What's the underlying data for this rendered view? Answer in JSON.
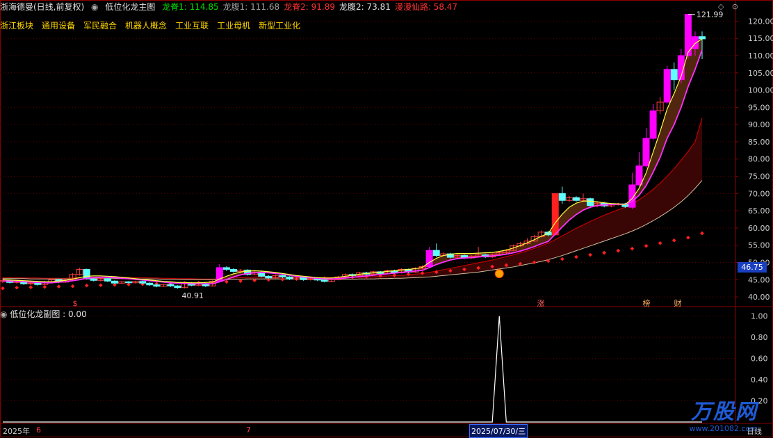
{
  "header": {
    "stock": "浙海德曼(日线,前复权)",
    "indicator": "低位化龙主图",
    "items": [
      {
        "label": "龙脊1: 114.85",
        "color": "#00e000"
      },
      {
        "label": "龙腹1: 111.68",
        "color": "#a0a0a0"
      },
      {
        "label": "龙脊2: 91.89",
        "color": "#ff3030"
      },
      {
        "label": "龙腹2: 73.81",
        "color": "#e0e0e0"
      },
      {
        "label": "漫漫仙路: 58.47",
        "color": "#ff3030"
      }
    ]
  },
  "sectors": [
    "浙江板块",
    "通用设备",
    "军民融合",
    "机器人概念",
    "工业互联",
    "工业母机",
    "新型工业化"
  ],
  "sub_chart": {
    "title": "低位化龙副图 : 0.00"
  },
  "price_label": "46.75",
  "max_label": "121.99",
  "min_label": "40.91",
  "markers": {
    "zhang": "涨",
    "bang": "榜",
    "cai": "财",
    "dollar": "$"
  },
  "dates": {
    "year": "2025年",
    "m6": "6",
    "m7": "7",
    "cursor": "2025/07/30/三"
  },
  "period": "日线",
  "watermark": {
    "brand": "万股网",
    "url": "www.201082.com"
  },
  "chart_data": {
    "type": "candlestick",
    "y_ticks": [
      40.0,
      45.0,
      50.0,
      55.0,
      60.0,
      65.0,
      70.0,
      75.0,
      80.0,
      85.0,
      90.0,
      95.0,
      100.0,
      105.0,
      110.0,
      115.0,
      120.0
    ],
    "ylim": [
      38.0,
      122.5
    ],
    "sub_y_ticks": [
      0.2,
      0.4,
      0.6,
      0.8,
      1.0
    ],
    "sub_ylim": [
      0.0,
      1.05
    ],
    "candles": [
      [
        44.5,
        44.8,
        44.0,
        45.5
      ],
      [
        44.8,
        44.2,
        43.9,
        45.0
      ],
      [
        44.2,
        44.6,
        43.8,
        44.9
      ],
      [
        44.6,
        43.8,
        43.5,
        44.8
      ],
      [
        43.8,
        44.0,
        43.4,
        44.3
      ],
      [
        44.0,
        43.6,
        43.3,
        44.2
      ],
      [
        43.6,
        44.4,
        43.5,
        44.7
      ],
      [
        44.4,
        45.0,
        44.1,
        45.3
      ],
      [
        45.0,
        44.3,
        44.0,
        45.1
      ],
      [
        44.3,
        44.9,
        44.1,
        45.2
      ],
      [
        44.9,
        46.5,
        44.7,
        46.9
      ],
      [
        46.5,
        48.0,
        46.2,
        48.5
      ],
      [
        48.0,
        45.2,
        45.0,
        48.2
      ],
      [
        45.2,
        44.8,
        44.5,
        45.6
      ],
      [
        44.8,
        45.3,
        44.5,
        45.6
      ],
      [
        45.3,
        44.6,
        44.3,
        45.4
      ],
      [
        44.6,
        44.0,
        43.8,
        44.8
      ],
      [
        44.0,
        44.4,
        43.8,
        44.6
      ],
      [
        44.4,
        44.1,
        43.9,
        44.6
      ],
      [
        44.1,
        44.5,
        43.9,
        44.7
      ],
      [
        44.5,
        44.0,
        43.7,
        44.7
      ],
      [
        44.0,
        43.5,
        43.2,
        44.2
      ],
      [
        43.5,
        43.1,
        42.8,
        43.8
      ],
      [
        43.1,
        43.6,
        42.9,
        43.8
      ],
      [
        43.6,
        43.2,
        42.9,
        43.9
      ],
      [
        43.2,
        42.7,
        42.4,
        43.4
      ],
      [
        42.7,
        44.0,
        42.5,
        44.2
      ],
      [
        44.0,
        43.4,
        43.1,
        44.3
      ],
      [
        43.4,
        43.9,
        43.1,
        44.1
      ],
      [
        43.9,
        43.2,
        42.9,
        44.1
      ],
      [
        43.2,
        44.5,
        43.0,
        44.8
      ],
      [
        44.5,
        48.5,
        44.3,
        49.5
      ],
      [
        48.5,
        48.0,
        47.5,
        48.9
      ],
      [
        48.0,
        47.4,
        47.0,
        48.3
      ],
      [
        47.4,
        47.8,
        47.0,
        48.1
      ],
      [
        47.8,
        46.5,
        46.2,
        48.0
      ],
      [
        46.5,
        47.2,
        46.3,
        47.5
      ],
      [
        47.2,
        46.0,
        45.7,
        47.4
      ],
      [
        46.0,
        45.5,
        45.2,
        46.3
      ],
      [
        45.5,
        46.2,
        45.3,
        46.5
      ],
      [
        46.2,
        45.8,
        45.5,
        46.5
      ],
      [
        45.8,
        45.2,
        44.9,
        46.0
      ],
      [
        45.2,
        45.7,
        44.9,
        45.9
      ],
      [
        45.7,
        45.0,
        44.7,
        45.9
      ],
      [
        45.0,
        45.5,
        44.8,
        45.8
      ],
      [
        45.5,
        44.9,
        44.6,
        45.7
      ],
      [
        44.9,
        44.5,
        44.2,
        45.1
      ],
      [
        44.5,
        45.0,
        44.2,
        45.3
      ],
      [
        45.0,
        45.8,
        44.8,
        46.1
      ],
      [
        45.8,
        46.5,
        45.6,
        46.8
      ],
      [
        46.5,
        46.2,
        45.9,
        46.8
      ],
      [
        46.2,
        47.0,
        46.0,
        47.3
      ],
      [
        47.0,
        46.6,
        46.3,
        47.3
      ],
      [
        46.6,
        47.3,
        46.3,
        47.6
      ],
      [
        47.3,
        46.8,
        46.5,
        47.5
      ],
      [
        46.8,
        47.6,
        46.6,
        47.9
      ],
      [
        47.6,
        47.0,
        46.7,
        47.9
      ],
      [
        47.0,
        48.0,
        46.8,
        48.3
      ],
      [
        48.0,
        47.2,
        46.9,
        48.2
      ],
      [
        47.2,
        48.3,
        47.0,
        48.6
      ],
      [
        48.3,
        48.8,
        48.0,
        49.2
      ],
      [
        48.8,
        53.5,
        48.6,
        54.5
      ],
      [
        53.5,
        52.0,
        51.5,
        55.5
      ],
      [
        52.0,
        52.5,
        51.8,
        52.9
      ],
      [
        52.5,
        51.5,
        51.2,
        52.8
      ],
      [
        51.5,
        52.0,
        51.2,
        52.3
      ],
      [
        52.0,
        51.3,
        51.0,
        52.3
      ],
      [
        51.3,
        51.8,
        51.0,
        52.1
      ],
      [
        51.8,
        52.2,
        51.6,
        54.5
      ],
      [
        52.2,
        51.6,
        51.3,
        52.5
      ],
      [
        51.6,
        52.3,
        51.3,
        52.6
      ],
      [
        52.3,
        52.8,
        52.0,
        53.2
      ],
      [
        52.8,
        53.5,
        52.5,
        53.9
      ],
      [
        53.5,
        54.8,
        53.3,
        55.2
      ],
      [
        54.8,
        55.5,
        54.5,
        56.0
      ],
      [
        55.5,
        56.2,
        55.2,
        57.0
      ],
      [
        56.2,
        57.5,
        56.0,
        58.0
      ],
      [
        57.5,
        58.8,
        57.2,
        59.3
      ],
      [
        58.8,
        58.0,
        57.6,
        59.2
      ],
      [
        58.0,
        70.0,
        58.0,
        70.0
      ],
      [
        70.0,
        68.0,
        67.0,
        72.0
      ],
      [
        68.0,
        68.8,
        67.5,
        69.3
      ],
      [
        68.8,
        68.0,
        67.6,
        69.2
      ],
      [
        68.0,
        68.5,
        67.6,
        70.0
      ],
      [
        68.5,
        66.5,
        66.0,
        68.8
      ],
      [
        66.5,
        67.2,
        66.0,
        67.5
      ],
      [
        67.2,
        66.4,
        66.0,
        67.6
      ],
      [
        66.4,
        66.8,
        66.0,
        67.2
      ],
      [
        66.8,
        67.0,
        66.5,
        67.3
      ],
      [
        67.0,
        66.2,
        65.8,
        67.3
      ],
      [
        66.0,
        72.5,
        65.5,
        76.0
      ],
      [
        72.5,
        78.0,
        72.0,
        82.0
      ],
      [
        78.0,
        86.0,
        77.5,
        89.0
      ],
      [
        86.0,
        94.0,
        85.5,
        96.0
      ],
      [
        94.0,
        96.5,
        93.0,
        98.0
      ],
      [
        96.5,
        106.0,
        96.0,
        107.0
      ],
      [
        106.0,
        103.0,
        100.0,
        108.0
      ],
      [
        103.0,
        110.0,
        102.0,
        112.0
      ],
      [
        110.0,
        121.99,
        109.0,
        121.99
      ],
      [
        112.0,
        115.5,
        110.0,
        117.0
      ],
      [
        115.5,
        114.85,
        109.0,
        117.0
      ]
    ],
    "series": [
      {
        "values": [
          44.6,
          44.6,
          44.5,
          44.4,
          44.3,
          44.2,
          44.1,
          44.1,
          44.3,
          44.4,
          44.7,
          45.0,
          45.4,
          45.6,
          45.7,
          45.7,
          45.6,
          45.4,
          45.3,
          45.1,
          44.9,
          44.7,
          44.5,
          44.3,
          44.1,
          44.0,
          43.9,
          43.8,
          43.8,
          43.8,
          43.8,
          44.4,
          45.1,
          45.8,
          46.4,
          46.8,
          47.0,
          47.1,
          47.0,
          46.8,
          46.6,
          46.3,
          46.0,
          45.8,
          45.6,
          45.4,
          45.3,
          45.2,
          45.3,
          45.5,
          45.7,
          45.9,
          46.1,
          46.3,
          46.5,
          46.7,
          46.9,
          47.1,
          47.3,
          47.5,
          47.7,
          48.5,
          49.4,
          50.1,
          50.7,
          51.1,
          51.3,
          51.4,
          51.6,
          51.8,
          51.9,
          52.1,
          52.4,
          52.8,
          53.3,
          53.9,
          54.6,
          55.4,
          56.1,
          58.2,
          60.3,
          62.3,
          63.9,
          65.2,
          66.0,
          66.5,
          66.7,
          66.8,
          66.9,
          66.8,
          67.7,
          69.5,
          72.3,
          76.2,
          80.5,
          86.0,
          90.0,
          95.0,
          101.0,
          106.0,
          111.68
        ]
      },
      {
        "values": [
          45.0,
          44.9,
          44.8,
          44.7,
          44.6,
          44.5,
          44.4,
          44.4,
          44.6,
          44.8,
          45.2,
          45.6,
          46.0,
          46.1,
          46.1,
          46.0,
          45.9,
          45.7,
          45.5,
          45.3,
          45.1,
          44.9,
          44.7,
          44.5,
          44.4,
          44.2,
          44.2,
          44.1,
          44.1,
          44.2,
          44.3,
          45.2,
          46.0,
          46.7,
          47.2,
          47.5,
          47.6,
          47.5,
          47.3,
          47.1,
          46.8,
          46.5,
          46.2,
          46.0,
          45.8,
          45.6,
          45.5,
          45.5,
          45.7,
          46.0,
          46.3,
          46.6,
          46.8,
          47.0,
          47.2,
          47.4,
          47.6,
          47.8,
          48.0,
          48.2,
          48.6,
          50.0,
          51.2,
          52.0,
          52.4,
          52.6,
          52.6,
          52.6,
          52.7,
          52.8,
          52.9,
          53.2,
          53.6,
          54.2,
          54.9,
          55.7,
          56.6,
          57.6,
          58.4,
          61.5,
          64.0,
          66.0,
          67.2,
          67.8,
          67.8,
          67.6,
          67.3,
          67.1,
          67.0,
          66.8,
          68.5,
          71.5,
          76.0,
          82.0,
          88.0,
          94.5,
          99.0,
          104.0,
          111.0,
          113.5,
          114.85
        ]
      },
      {
        "values": [
          45.6,
          45.6,
          45.6,
          45.5,
          45.5,
          45.5,
          45.4,
          45.4,
          45.4,
          45.4,
          45.5,
          45.6,
          45.7,
          45.7,
          45.7,
          45.7,
          45.7,
          45.7,
          45.6,
          45.6,
          45.6,
          45.5,
          45.5,
          45.4,
          45.4,
          45.3,
          45.3,
          45.3,
          45.2,
          45.2,
          45.2,
          45.3,
          45.4,
          45.5,
          45.6,
          45.7,
          45.8,
          45.8,
          45.8,
          45.8,
          45.8,
          45.8,
          45.7,
          45.7,
          45.7,
          45.6,
          45.6,
          45.6,
          45.6,
          45.6,
          45.7,
          45.7,
          45.8,
          45.9,
          46.0,
          46.1,
          46.2,
          46.3,
          46.4,
          46.6,
          46.8,
          47.1,
          47.5,
          47.9,
          48.3,
          48.7,
          49.1,
          49.5,
          49.9,
          50.3,
          50.7,
          51.2,
          51.7,
          52.2,
          52.8,
          53.4,
          54.1,
          54.8,
          55.6,
          56.6,
          57.7,
          58.8,
          59.9,
          60.9,
          61.9,
          62.8,
          63.7,
          64.5,
          65.3,
          66.0,
          67.0,
          68.2,
          69.6,
          71.2,
          73.0,
          75.0,
          77.2,
          79.6,
          82.2,
          85.0,
          91.89
        ]
      },
      {
        "values": [
          45.3,
          45.3,
          45.3,
          45.3,
          45.2,
          45.2,
          45.2,
          45.2,
          45.2,
          45.2,
          45.2,
          45.3,
          45.3,
          45.3,
          45.3,
          45.3,
          45.3,
          45.3,
          45.3,
          45.2,
          45.2,
          45.2,
          45.2,
          45.1,
          45.1,
          45.1,
          45.0,
          45.0,
          45.0,
          45.0,
          45.0,
          45.0,
          45.0,
          45.1,
          45.1,
          45.2,
          45.2,
          45.2,
          45.2,
          45.2,
          45.2,
          45.2,
          45.2,
          45.2,
          45.2,
          45.1,
          45.1,
          45.1,
          45.1,
          45.1,
          45.1,
          45.2,
          45.2,
          45.2,
          45.3,
          45.3,
          45.4,
          45.4,
          45.5,
          45.6,
          45.7,
          45.8,
          46.0,
          46.2,
          46.4,
          46.6,
          46.8,
          47.0,
          47.2,
          47.5,
          47.8,
          48.1,
          48.4,
          48.7,
          49.1,
          49.5,
          49.9,
          50.3,
          50.8,
          51.4,
          52.0,
          52.7,
          53.4,
          54.1,
          54.8,
          55.5,
          56.2,
          56.9,
          57.6,
          58.3,
          59.1,
          60.0,
          61.0,
          62.1,
          63.3,
          64.6,
          66.0,
          67.6,
          69.4,
          71.5,
          73.81
        ]
      },
      {
        "values": [
          42.5,
          42.6,
          42.7,
          42.7,
          42.8,
          42.8,
          42.9,
          42.9,
          43.0,
          43.0,
          43.1,
          43.2,
          43.3,
          43.3,
          43.4,
          43.4,
          43.5,
          43.5,
          43.6,
          43.6,
          43.7,
          43.7,
          43.8,
          43.8,
          43.9,
          43.9,
          44.0,
          44.0,
          44.1,
          44.1,
          44.2,
          44.3,
          44.4,
          44.5,
          44.6,
          44.7,
          44.8,
          44.9,
          45.0,
          45.0,
          45.1,
          45.1,
          45.2,
          45.2,
          45.3,
          45.3,
          45.4,
          45.4,
          45.5,
          45.6,
          45.7,
          45.8,
          45.9,
          46.0,
          46.1,
          46.2,
          46.3,
          46.4,
          46.6,
          46.7,
          46.9,
          47.0,
          47.2,
          47.4,
          47.6,
          47.8,
          48.0,
          48.2,
          48.4,
          48.6,
          48.8,
          49.0,
          49.2,
          49.4,
          49.6,
          49.8,
          50.0,
          50.2,
          50.4,
          50.7,
          51.0,
          51.3,
          51.6,
          51.9,
          52.2,
          52.5,
          52.8,
          53.1,
          53.4,
          53.7,
          54.0,
          54.4,
          54.8,
          55.2,
          55.6,
          56.0,
          56.4,
          56.8,
          57.2,
          57.8,
          58.47
        ]
      },
      {
        "values": [
          0,
          0,
          0,
          0,
          0,
          0,
          0,
          0,
          0,
          0,
          0,
          0,
          0,
          0,
          0,
          0,
          0,
          0,
          0,
          0,
          0,
          0,
          0,
          0,
          0,
          0,
          0,
          0,
          0,
          0,
          0,
          0,
          0,
          0,
          0,
          0,
          0,
          0,
          0,
          0,
          0,
          0,
          0,
          0,
          0,
          0,
          0,
          0,
          0,
          0,
          0,
          0,
          0,
          0,
          0,
          0,
          0,
          0,
          0,
          0,
          0,
          0,
          0,
          0,
          0,
          0,
          0,
          0,
          0,
          0,
          0,
          1,
          0,
          0,
          0,
          0,
          0,
          0,
          0,
          0,
          0,
          0,
          0,
          0,
          0,
          0,
          0,
          0,
          0,
          0,
          0,
          0,
          0,
          0,
          0,
          0,
          0,
          0,
          0,
          0,
          0
        ]
      }
    ],
    "signal": {
      "x": 71,
      "value": 46.75
    }
  }
}
